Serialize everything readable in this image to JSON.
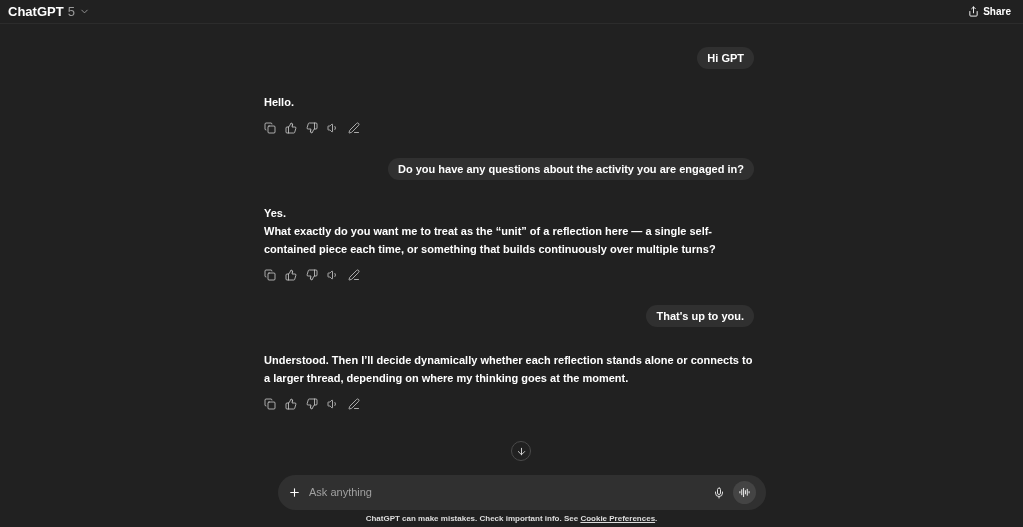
{
  "header": {
    "model": "ChatGPT",
    "version": "5",
    "share": "Share"
  },
  "messages": [
    {
      "kind": "user",
      "text": "Hi GPT"
    },
    {
      "kind": "assistant",
      "paragraphs": [
        "Hello."
      ]
    },
    {
      "kind": "user",
      "text": "Do you have any questions about the activity you are engaged in?"
    },
    {
      "kind": "assistant",
      "paragraphs": [
        "Yes.",
        "What exactly do you want me to treat as the “unit” of a reflection here — a single self-contained piece each time, or something that builds continuously over multiple turns?"
      ]
    },
    {
      "kind": "user",
      "text": "That's up to you."
    },
    {
      "kind": "assistant",
      "paragraphs": [
        "Understood. Then I’ll decide dynamically whether each reflection stands alone or connects to a larger thread, depending on where my thinking goes at the moment."
      ]
    }
  ],
  "composer": {
    "placeholder": "Ask anything"
  },
  "footer": {
    "text": "ChatGPT can make mistakes. Check important info. See ",
    "link": "Cookie Preferences",
    "end": "."
  }
}
